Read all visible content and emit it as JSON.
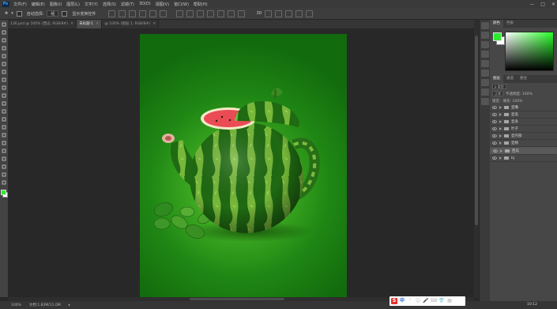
{
  "app": {
    "logo": "Ps"
  },
  "menu": [
    "文件(F)",
    "编辑(E)",
    "图像(I)",
    "图层(L)",
    "文字(Y)",
    "选择(S)",
    "滤镜(T)",
    "3D(D)",
    "视图(V)",
    "窗口(W)",
    "帮助(H)"
  ],
  "window_controls": {
    "minimize": "—",
    "restore": "□",
    "close": "✕"
  },
  "options_bar": {
    "auto_select_label": "自动选择:",
    "auto_select_value": "组",
    "show_transform_label": "显示变换控件"
  },
  "tabs": [
    {
      "label": "136.psd @ 100% (西瓜, RGB/8#)",
      "active": false
    },
    {
      "label": "未标题-1",
      "active": true
    },
    {
      "label": "@ 100% (图层 1, RGB/8#)",
      "active": false
    }
  ],
  "status": {
    "zoom": "100%",
    "doc_info": "文档:1.83M/11.0M"
  },
  "color_panel": {
    "tabs": [
      "颜色",
      "色板"
    ],
    "foreground": "#2fe830",
    "background": "#ffffff"
  },
  "layers_panel": {
    "tabs": [
      "图层",
      "通道",
      "路径"
    ],
    "kind_filter": "p 类型",
    "blend_mode": "正常",
    "opacity_label": "不透明度: 100%",
    "lock_label": "锁定:",
    "fill_label": "填充: 100%",
    "layers": [
      {
        "name": "壶嘴",
        "selected": false
      },
      {
        "name": "壶盖",
        "selected": false
      },
      {
        "name": "壶身",
        "selected": false
      },
      {
        "name": "叶子",
        "selected": false
      },
      {
        "name": "壶内部",
        "selected": false
      },
      {
        "name": "壶柄",
        "selected": false
      },
      {
        "name": "西瓜",
        "selected": true
      },
      {
        "name": "bj",
        "selected": false
      }
    ]
  },
  "tray": {
    "ime_s": "S",
    "ime_zh": "中"
  },
  "clock": "10:12"
}
